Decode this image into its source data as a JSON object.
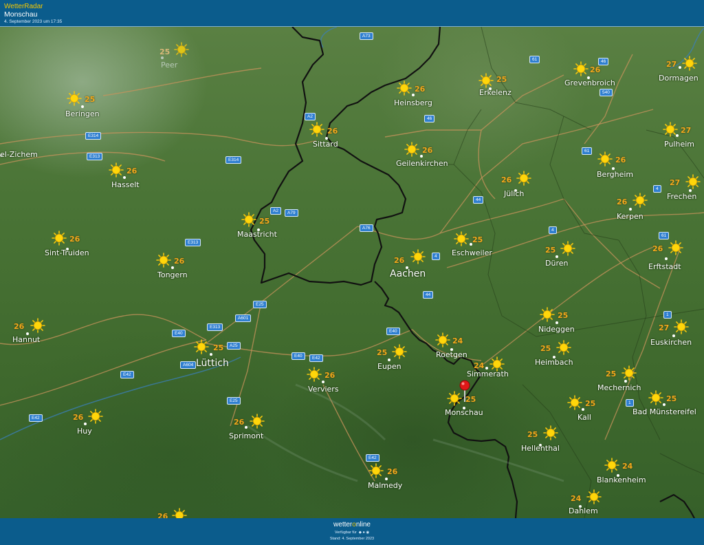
{
  "header": {
    "brand": "WetterRadar",
    "place": "Monschau",
    "date": "4. September 2023 um 17:35"
  },
  "map": {
    "road_badges": [
      "A73",
      "61",
      "46",
      "540",
      "A2",
      "46",
      "E314",
      "E313",
      "E314",
      "61",
      "A2",
      "A79",
      "44",
      "4",
      "A76",
      "E313",
      "4",
      "61",
      "4",
      "44",
      "1",
      "E25",
      "A601",
      "E313",
      "E40",
      "E40",
      "A25",
      "E40",
      "E42",
      "A604",
      "E42",
      "E25",
      "E42",
      "1",
      "E42"
    ],
    "cities": [
      {
        "name": "Peer",
        "temp": "25"
      },
      {
        "name": "Beringen",
        "temp": "25"
      },
      {
        "name": "el-Zichem",
        "temp": ""
      },
      {
        "name": "Hasselt",
        "temp": "26"
      },
      {
        "name": "Sint-Truiden",
        "temp": "26"
      },
      {
        "name": "Tongern",
        "temp": "26"
      },
      {
        "name": "Hannut",
        "temp": "26"
      },
      {
        "name": "Lüttich",
        "temp": "25"
      },
      {
        "name": "Huy",
        "temp": "26"
      },
      {
        "name": "Sprimont",
        "temp": "26"
      },
      {
        "name": "Verviers",
        "temp": "26"
      },
      {
        "name": "Eupen",
        "temp": "25"
      },
      {
        "name": "Malmedy",
        "temp": "26"
      },
      {
        "name": "Maastricht",
        "temp": "25"
      },
      {
        "name": "Sittard",
        "temp": "26"
      },
      {
        "name": "Heinsberg",
        "temp": "26"
      },
      {
        "name": "Erkelenz",
        "temp": "25"
      },
      {
        "name": "Geilenkirchen",
        "temp": "26"
      },
      {
        "name": "Aachen",
        "temp": "26"
      },
      {
        "name": "Eschweiler",
        "temp": "25"
      },
      {
        "name": "Jülich",
        "temp": "26"
      },
      {
        "name": "Düren",
        "temp": "25"
      },
      {
        "name": "Roetgen",
        "temp": "24"
      },
      {
        "name": "Simmerath",
        "temp": "24"
      },
      {
        "name": "Monschau",
        "temp": "25"
      },
      {
        "name": "Nideggen",
        "temp": "25"
      },
      {
        "name": "Heimbach",
        "temp": "25"
      },
      {
        "name": "Hellenthal",
        "temp": "25"
      },
      {
        "name": "Kall",
        "temp": "25"
      },
      {
        "name": "Mechernich",
        "temp": "25"
      },
      {
        "name": "Blankenheim",
        "temp": "24"
      },
      {
        "name": "Dahlem",
        "temp": "24"
      },
      {
        "name": "Grevenbroich",
        "temp": "26"
      },
      {
        "name": "Dormagen",
        "temp": "27"
      },
      {
        "name": "Pulheim",
        "temp": "27"
      },
      {
        "name": "Bergheim",
        "temp": "26"
      },
      {
        "name": "Frechen",
        "temp": "27"
      },
      {
        "name": "Kerpen",
        "temp": "26"
      },
      {
        "name": "Erftstadt",
        "temp": "26"
      },
      {
        "name": "Euskirchen",
        "temp": "27"
      },
      {
        "name": "Bad Münstereifel",
        "temp": "25"
      },
      {
        "name": "",
        "temp": "26"
      }
    ],
    "weather_icon": "sun-icon",
    "marker_icon": "location-pin-icon"
  },
  "footer": {
    "logo_part1": "wetter",
    "logo_part2": "o",
    "logo_part3": "nline",
    "availability": "Verfügbar für",
    "stand": "Stand: 4. September 2023"
  },
  "colors": {
    "header_bg": "#0b5c8c",
    "brand_yellow": "#f6c900",
    "temperature": "#f5a81c",
    "road_badge": "#2f7fd0",
    "marker_red": "#e01818"
  }
}
